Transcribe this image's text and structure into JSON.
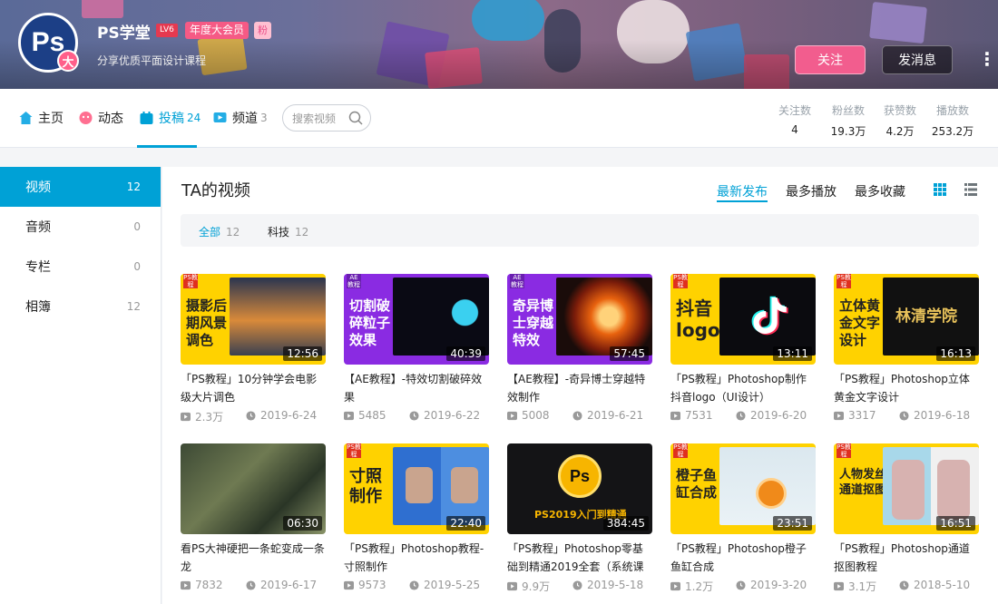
{
  "header": {
    "username": "PS学堂",
    "level": "LV6",
    "vip_badge": "年度大会员",
    "fan_badge": "粉",
    "signature": "分享优质平面设计课程",
    "avatar_text": "Ps",
    "avatar_tag": "大",
    "follow_label": "关注",
    "message_label": "发消息"
  },
  "nav": {
    "items": [
      {
        "label": "主页",
        "count": "",
        "icon": "home-icon"
      },
      {
        "label": "动态",
        "count": "",
        "icon": "dynamic-icon"
      },
      {
        "label": "投稿",
        "count": "24",
        "icon": "upload-icon"
      },
      {
        "label": "频道",
        "count": "3",
        "icon": "channel-icon"
      }
    ],
    "search_placeholder": "搜索视频"
  },
  "stats": [
    {
      "label": "关注数",
      "value": "4"
    },
    {
      "label": "粉丝数",
      "value": "19.3万"
    },
    {
      "label": "获赞数",
      "value": "4.2万"
    },
    {
      "label": "播放数",
      "value": "253.2万"
    }
  ],
  "sidebar": {
    "items": [
      {
        "label": "视频",
        "count": "12"
      },
      {
        "label": "音频",
        "count": "0"
      },
      {
        "label": "专栏",
        "count": "0"
      },
      {
        "label": "相簿",
        "count": "12"
      }
    ]
  },
  "main": {
    "title": "TA的视频",
    "sort": [
      "最新发布",
      "最多播放",
      "最多收藏"
    ],
    "filters": [
      {
        "label": "全部",
        "count": "12"
      },
      {
        "label": "科技",
        "count": "12"
      }
    ]
  },
  "colors": {
    "accent": "#00a1d6",
    "pink": "#f25d8e",
    "thumb_yellow": "#ffd200",
    "thumb_purple": "#8a2be2"
  },
  "videos": [
    {
      "title": "「PS教程」10分钟学会电影级大片调色",
      "duration": "12:56",
      "plays": "2.3万",
      "date": "2019-6-24",
      "thumb_text": "摄影后期风景调色",
      "corner": "PS教程"
    },
    {
      "title": "【AE教程】-特效切割破碎效果",
      "duration": "40:39",
      "plays": "5485",
      "date": "2019-6-22",
      "thumb_text": "切割破碎粒子效果",
      "corner": "AE教程"
    },
    {
      "title": "【AE教程】-奇异博士穿越特效制作",
      "duration": "57:45",
      "plays": "5008",
      "date": "2019-6-21",
      "thumb_text": "奇异博士穿越特效",
      "corner": "AE教程"
    },
    {
      "title": "「PS教程」Photoshop制作抖音logo（UI设计）",
      "duration": "13:11",
      "plays": "7531",
      "date": "2019-6-20",
      "thumb_text": "抖音logo",
      "corner": "PS教程"
    },
    {
      "title": "「PS教程」Photoshop立体黄金文字设计",
      "duration": "16:13",
      "plays": "3317",
      "date": "2019-6-18",
      "thumb_text": "立体黄金文字设计",
      "corner": "PS教程",
      "screen_text": "林清学院"
    },
    {
      "title": "看PS大神硬把一条蛇变成一条龙",
      "duration": "06:30",
      "plays": "7832",
      "date": "2019-6-17",
      "thumb_text": "",
      "corner": ""
    },
    {
      "title": "「PS教程」Photoshop教程-寸照制作",
      "duration": "22:40",
      "plays": "9573",
      "date": "2019-5-25",
      "thumb_text": "寸照制作",
      "corner": "PS教程"
    },
    {
      "title": "「PS教程」Photoshop零基础到精通2019全套（系统课",
      "duration": "384:45",
      "plays": "9.9万",
      "date": "2019-5-18",
      "thumb_text": "",
      "corner": "",
      "screen_text": "PS2019入门到精通"
    },
    {
      "title": "「PS教程」Photoshop橙子鱼缸合成",
      "duration": "23:51",
      "plays": "1.2万",
      "date": "2019-3-20",
      "thumb_text": "橙子鱼缸合成",
      "corner": "PS教程"
    },
    {
      "title": "「PS教程」Photoshop通道抠图教程",
      "duration": "16:51",
      "plays": "3.1万",
      "date": "2018-5-10",
      "thumb_text": "人物发丝通道抠图",
      "corner": "PS教程"
    }
  ]
}
